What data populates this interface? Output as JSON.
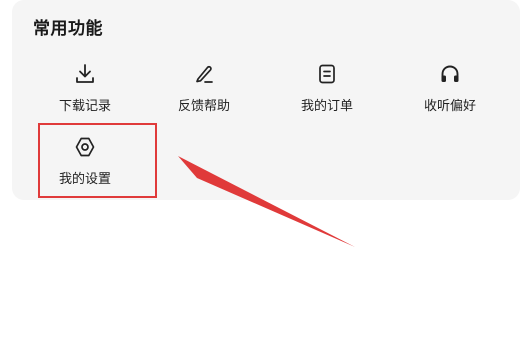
{
  "section": {
    "title": "常用功能"
  },
  "tools": [
    {
      "label": "下载记录",
      "icon": "download-icon"
    },
    {
      "label": "反馈帮助",
      "icon": "pencil-icon"
    },
    {
      "label": "我的订单",
      "icon": "document-icon"
    },
    {
      "label": "收听偏好",
      "icon": "headphones-icon"
    },
    {
      "label": "我的设置",
      "icon": "settings-icon"
    }
  ],
  "annotation": {
    "highlight_color": "#e03a3a",
    "arrow_color": "#e03a3a"
  },
  "colors": {
    "card_background": "#f5f5f5",
    "text": "#222222"
  }
}
